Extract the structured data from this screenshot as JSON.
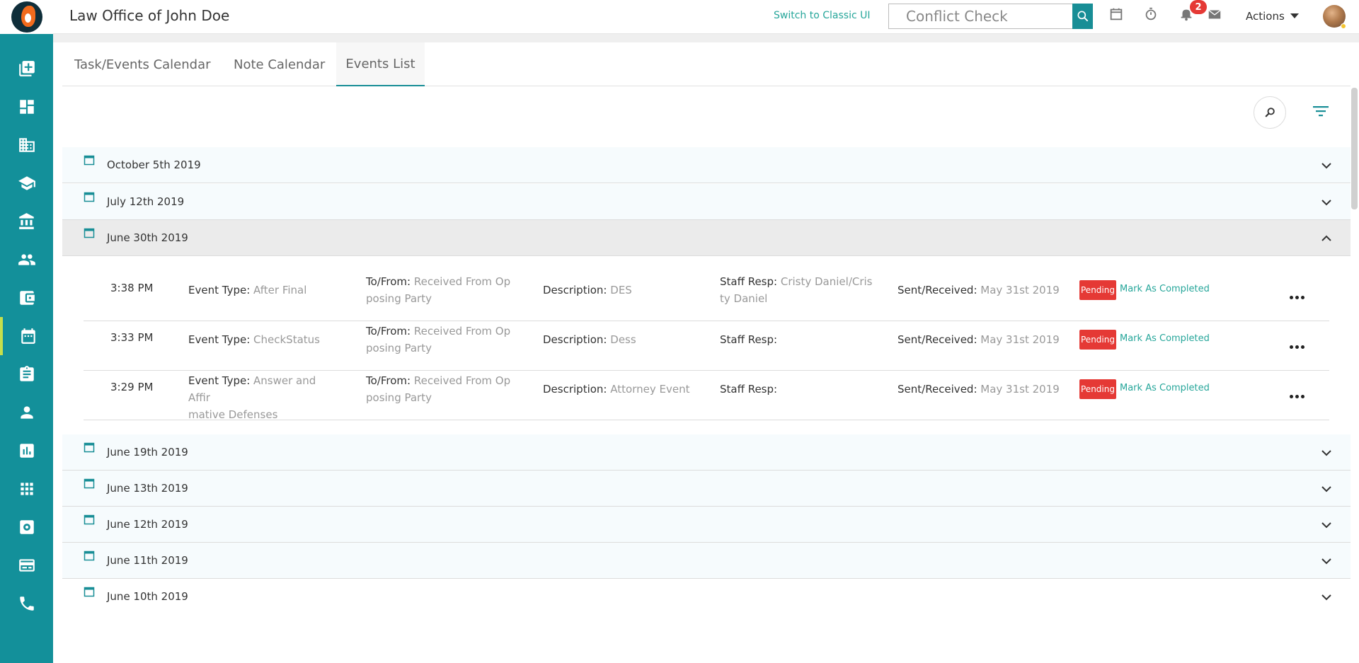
{
  "header": {
    "firm_name": "Law Office of John Doe",
    "classic_link": "Switch to Classic UI",
    "search_placeholder": "Conflict Check",
    "notification_count": "2",
    "actions_label": "Actions"
  },
  "tabs": [
    {
      "label": "Task/Events Calendar"
    },
    {
      "label": "Note Calendar"
    },
    {
      "label": "Events List"
    }
  ],
  "active_tab": "Events List",
  "dates": [
    {
      "label": "October 5th 2019"
    },
    {
      "label": "July 12th 2019"
    },
    {
      "label": "June 30th 2019"
    },
    {
      "label": "June 19th 2019"
    },
    {
      "label": "June 13th 2019"
    },
    {
      "label": "June 12th 2019"
    },
    {
      "label": "June 11th 2019"
    },
    {
      "label": "June 10th 2019"
    }
  ],
  "event_labels": {
    "event_type": "Event Type:",
    "to_from": "To/From:",
    "description": "Description:",
    "staff_resp": "Staff Resp:",
    "sent_received": "Sent/Received:",
    "status": "Pending",
    "mark_completed": "Mark As Completed"
  },
  "events": [
    {
      "time": "3:38 PM",
      "event_type_1": "After Final",
      "event_type_2": "",
      "to_from_1": "Received From Op",
      "to_from_2": "posing Party",
      "description": "DES",
      "staff_resp_1": "Cristy Daniel/Cris",
      "staff_resp_2": "ty Daniel",
      "sent_received": "May 31st 2019"
    },
    {
      "time": "3:33 PM",
      "event_type_1": "CheckStatus",
      "event_type_2": "",
      "to_from_1": "Received From Op",
      "to_from_2": "posing Party",
      "description": "Dess",
      "staff_resp_1": "",
      "staff_resp_2": "",
      "sent_received": "May 31st 2019"
    },
    {
      "time": "3:29 PM",
      "event_type_1": "Answer and Affir",
      "event_type_2": "mative Defenses",
      "to_from_1": "Received From Op",
      "to_from_2": "posing Party",
      "description": "Attorney Event",
      "staff_resp_1": "",
      "staff_resp_2": "",
      "sent_received": "May 31st 2019"
    }
  ],
  "colors": {
    "brand_teal": "#13909a",
    "accent": "#26a69a",
    "pending_red": "#e53935",
    "active_marker": "#c5e04c"
  },
  "sidebar_icons": [
    "add-matter-icon",
    "dashboard-icon",
    "building-icon",
    "school-icon",
    "bank-icon",
    "people-icon",
    "wallet-icon",
    "calendar-icon",
    "clipboard-icon",
    "person-icon",
    "chart-icon",
    "apps-icon",
    "settings-icon",
    "card-icon",
    "phone-icon"
  ]
}
